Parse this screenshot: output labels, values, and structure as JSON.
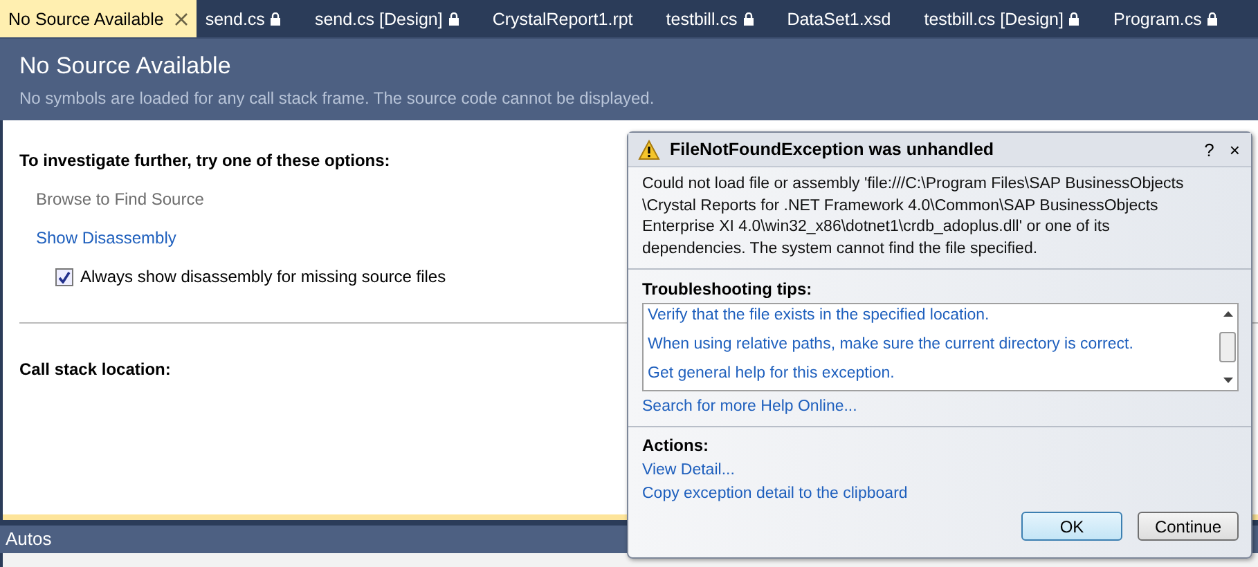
{
  "tabs": [
    {
      "label": "No Source Available",
      "selected": true,
      "locked": false,
      "closable": true
    },
    {
      "label": "send.cs",
      "selected": false,
      "locked": true,
      "closable": false
    },
    {
      "label": "send.cs [Design]",
      "selected": false,
      "locked": true,
      "closable": false
    },
    {
      "label": "CrystalReport1.rpt",
      "selected": false,
      "locked": false,
      "closable": false
    },
    {
      "label": "testbill.cs",
      "selected": false,
      "locked": true,
      "closable": false
    },
    {
      "label": "DataSet1.xsd",
      "selected": false,
      "locked": false,
      "closable": false
    },
    {
      "label": "testbill.cs [Design]",
      "selected": false,
      "locked": true,
      "closable": false
    },
    {
      "label": "Program.cs",
      "selected": false,
      "locked": true,
      "closable": false
    }
  ],
  "header": {
    "title": "No Source Available",
    "subtitle": "No symbols are loaded for any call stack frame. The source code cannot be displayed."
  },
  "options": {
    "heading": "To investigate further, try one of these options:",
    "links": [
      {
        "label": "Browse to Find Source",
        "disabled": true
      },
      {
        "label": "Show Disassembly",
        "disabled": false
      }
    ],
    "checkbox": {
      "label": "Always show disassembly for missing source files",
      "checked": true
    }
  },
  "call_stack": {
    "heading": "Call stack location:"
  },
  "bottom_panel": {
    "title": "Autos"
  },
  "dialog": {
    "title": "FileNotFoundException was unhandled",
    "help": "?",
    "close": "×",
    "message": "Could not load file or assembly 'file:///C:\\Program Files\\SAP BusinessObjects \\Crystal Reports for .NET Framework 4.0\\Common\\SAP BusinessObjects Enterprise XI 4.0\\win32_x86\\dotnet1\\crdb_adoplus.dll' or one of its dependencies. The system cannot find the file specified.",
    "tips_heading": "Troubleshooting tips:",
    "tips": [
      "Verify that the file exists in the specified location.",
      "When using relative paths, make sure the current directory is correct.",
      "Get general help for this exception."
    ],
    "search_link": "Search for more Help Online...",
    "actions_heading": "Actions:",
    "actions": [
      "View Detail...",
      "Copy exception detail to the clipboard"
    ],
    "buttons": [
      {
        "label": "OK",
        "selected": true
      },
      {
        "label": "Continue",
        "selected": false
      }
    ]
  }
}
